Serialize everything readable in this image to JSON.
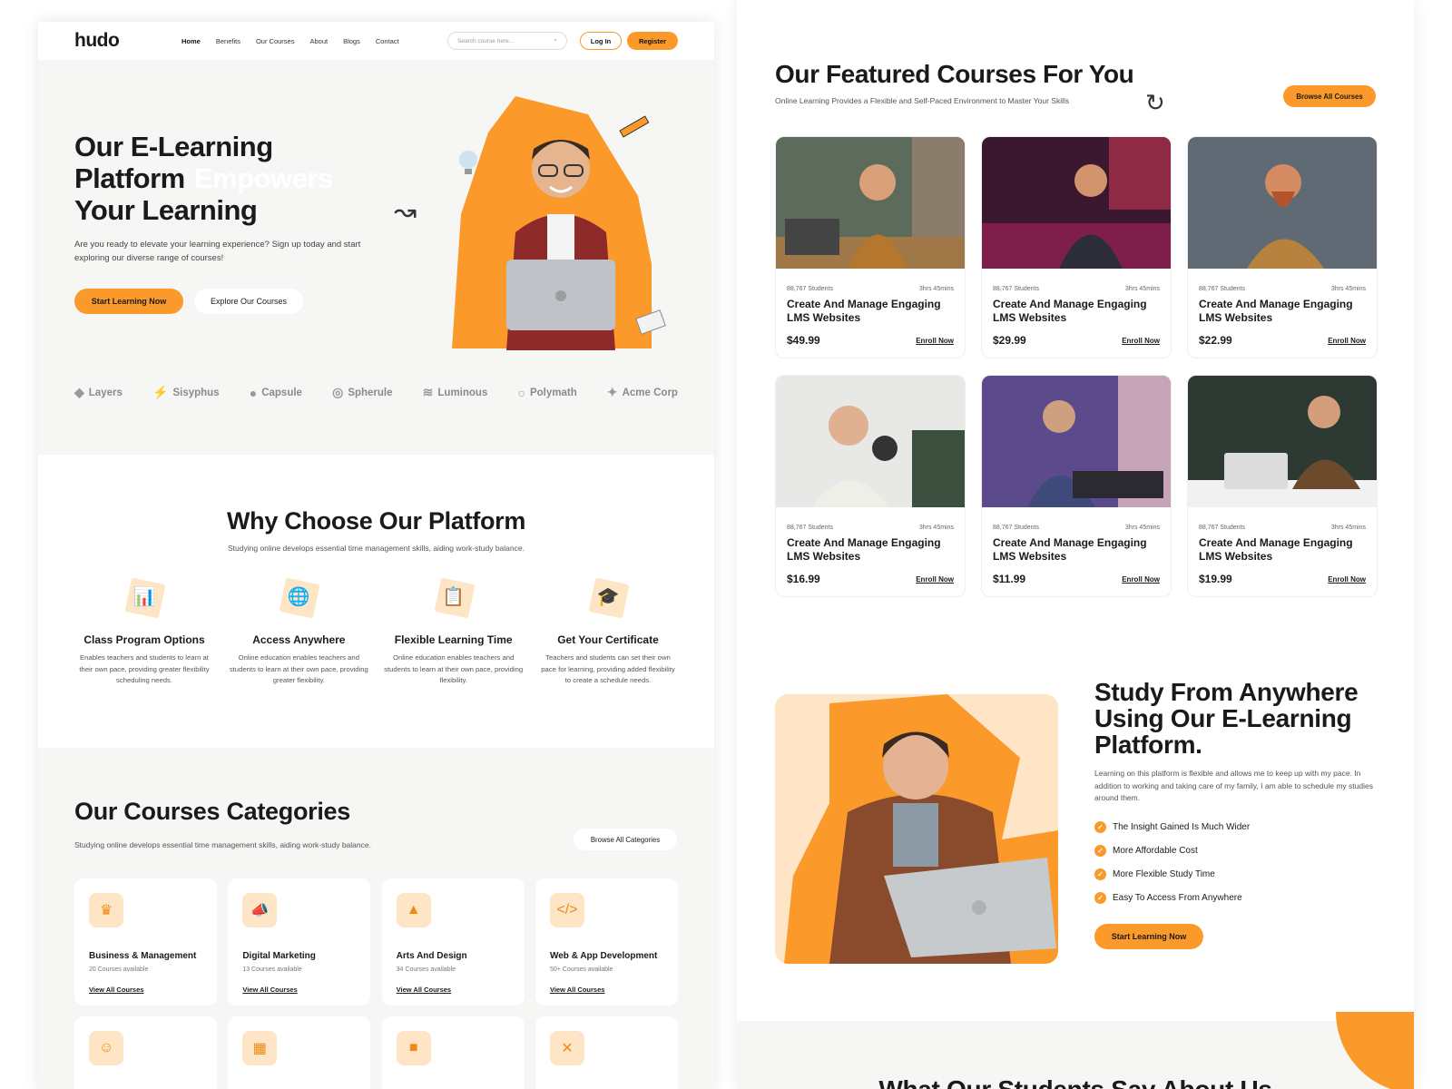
{
  "nav": {
    "logo": "hudo",
    "links": [
      "Home",
      "Benefits",
      "Our Courses",
      "About",
      "Blogs",
      "Contact"
    ],
    "search_placeholder": "Search course here...",
    "login": "Log In",
    "register": "Register"
  },
  "hero": {
    "title_1": "Our E-Learning",
    "title_2": "Platform",
    "title_highlight": "Empowers",
    "title_3": "Your Learning",
    "paragraph": "Are you ready to elevate your learning experience? Sign up today and start exploring our diverse range of courses!",
    "btn_start": "Start Learning Now",
    "btn_explore": "Explore Our Courses"
  },
  "partners": [
    "Layers",
    "Sisyphus",
    "Capsule",
    "Spherule",
    "Luminous",
    "Polymath",
    "Acme Corp"
  ],
  "why": {
    "title": "Why Choose Our Platform",
    "subtitle": "Studying online develops essential time management skills, aiding work-study balance.",
    "features": [
      {
        "title": "Class Program Options",
        "desc": "Enables teachers and students to learn at their own pace, providing greater flexibility scheduling needs."
      },
      {
        "title": "Access Anywhere",
        "desc": "Online education enables teachers and students to learn at their own pace, providing greater flexibility."
      },
      {
        "title": "Flexible Learning Time",
        "desc": "Online education enables teachers and students to learn at their own pace, providing flexibility."
      },
      {
        "title": "Get Your Certificate",
        "desc": "Teachers and students can set their own pace for learning, providing added flexibility to create a schedule needs."
      }
    ]
  },
  "categories": {
    "title": "Our Courses Categories",
    "subtitle": "Studying online develops essential time management skills, aiding work-study balance.",
    "browse": "Browse All Categories",
    "items": [
      {
        "name": "Business & Management",
        "count": "20 Courses available",
        "link": "View All Courses"
      },
      {
        "name": "Digital Marketing",
        "count": "13 Courses available",
        "link": "View All Courses"
      },
      {
        "name": "Arts And Design",
        "count": "34 Courses available",
        "link": "View All Courses"
      },
      {
        "name": "Web & App Development",
        "count": "50+ Courses available",
        "link": "View All Courses"
      }
    ]
  },
  "featured": {
    "title": "Our Featured Courses For You",
    "subtitle": "Online Learning Provides a Flexible and Self-Paced Environment to Master Your Skills",
    "browse": "Browse All Courses",
    "courses": [
      {
        "students": "88,767 Students",
        "duration": "3hrs 45mins",
        "title": "Create And Manage Engaging LMS Websites",
        "price": "$49.99",
        "enroll": "Enroll Now"
      },
      {
        "students": "88,767 Students",
        "duration": "3hrs 45mins",
        "title": "Create And Manage Engaging LMS Websites",
        "price": "$29.99",
        "enroll": "Enroll Now"
      },
      {
        "students": "88,767 Students",
        "duration": "3hrs 45mins",
        "title": "Create And Manage Engaging LMS Websites",
        "price": "$22.99",
        "enroll": "Enroll Now"
      },
      {
        "students": "88,767 Students",
        "duration": "3hrs 45mins",
        "title": "Create And Manage Engaging LMS Websites",
        "price": "$16.99",
        "enroll": "Enroll Now"
      },
      {
        "students": "88,767 Students",
        "duration": "3hrs 45mins",
        "title": "Create And Manage Engaging LMS Websites",
        "price": "$11.99",
        "enroll": "Enroll Now"
      },
      {
        "students": "88,767 Students",
        "duration": "3hrs 45mins",
        "title": "Create And Manage Engaging LMS Websites",
        "price": "$19.99",
        "enroll": "Enroll Now"
      }
    ]
  },
  "study": {
    "title": "Study From Anywhere Using Our E-Learning Platform.",
    "paragraph": "Learning on this platform is flexible and allows me to keep up with my pace. In addition to working and taking care of my family, I am able to schedule my studies around them.",
    "checks": [
      "The Insight Gained Is Much Wider",
      "More Affordable Cost",
      "More Flexible Study Time",
      "Easy To Access From Anywhere"
    ],
    "btn": "Start Learning Now"
  },
  "testimonials": {
    "title": "What Our Students Say About Us"
  },
  "colors": {
    "accent": "#fb9a2a",
    "accent_light": "#fde5c6",
    "bg_soft": "#f6f6f4"
  }
}
